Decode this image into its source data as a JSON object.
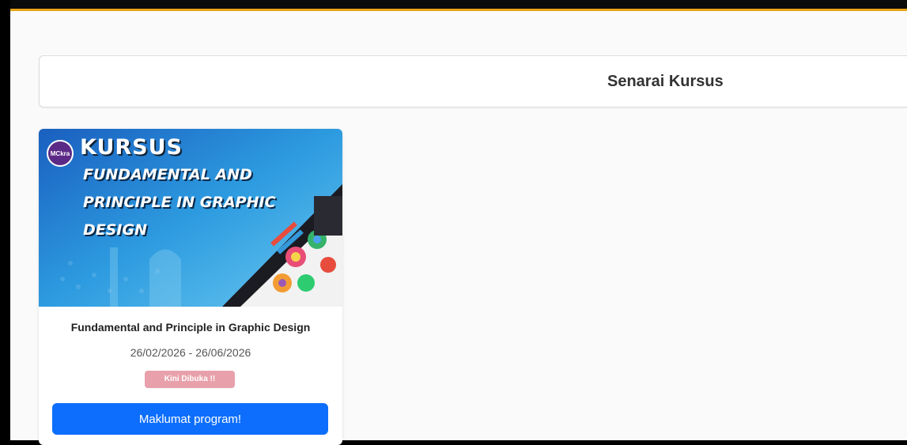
{
  "header": {
    "title": "Senarai Kursus"
  },
  "course": {
    "banner": {
      "logo_text": "MCkra",
      "kursus": "KURSUS",
      "lines": [
        "FUNDAMENTAL AND",
        "PRINCIPLE IN GRAPHIC",
        "DESIGN"
      ]
    },
    "title": "Fundamental and Principle in Graphic Design",
    "dates": "26/02/2026 - 26/06/2026",
    "status": "Kini Dibuka !!",
    "button_label": "Maklumat program!"
  },
  "colors": {
    "accent_bar": "#e8a317",
    "button": "#0d6efd",
    "badge": "#e8a1ab"
  }
}
